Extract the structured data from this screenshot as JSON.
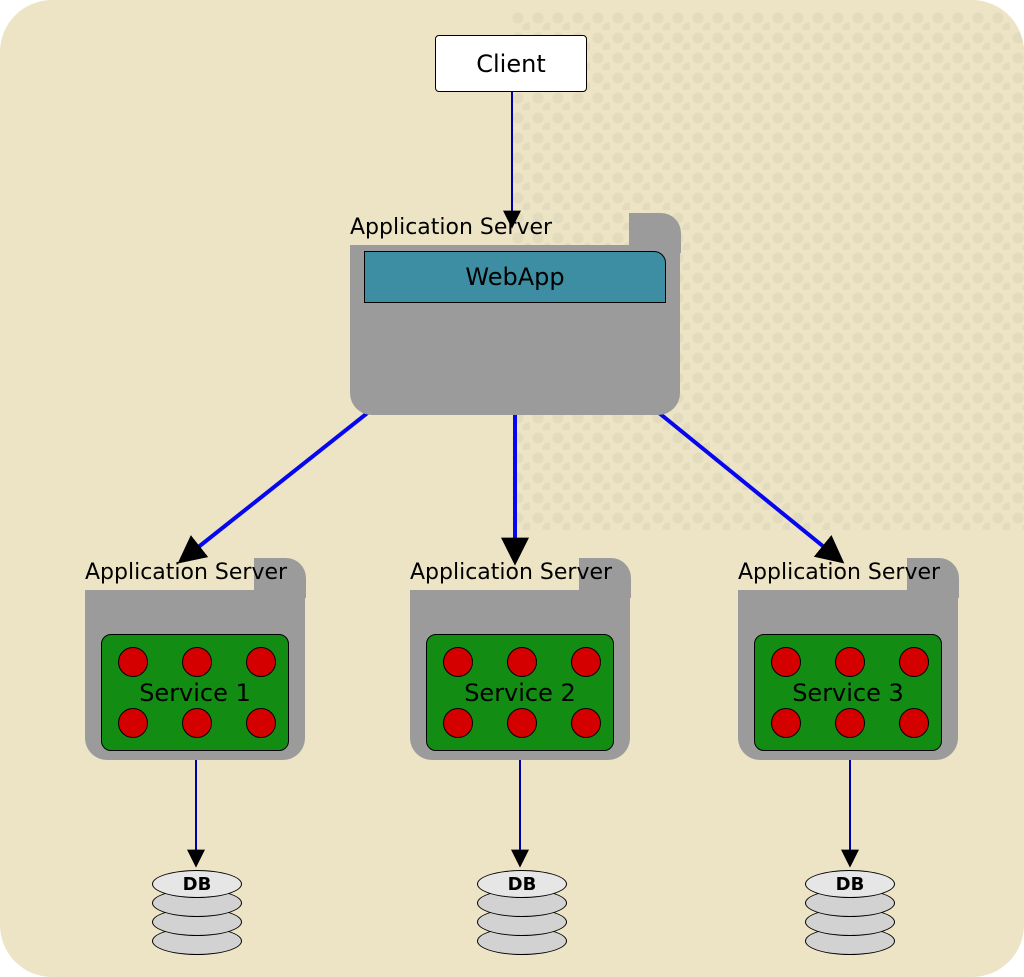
{
  "client_label": "Client",
  "webapp": {
    "server_title": "Application Server",
    "label": "WebApp"
  },
  "services": [
    {
      "server_title": "Application Server",
      "label": "Service 1",
      "db_label": "DB"
    },
    {
      "server_title": "Application Server",
      "label": "Service 2",
      "db_label": "DB"
    },
    {
      "server_title": "Application Server",
      "label": "Service 3",
      "db_label": "DB"
    }
  ],
  "colors": {
    "background": "#ece4c5",
    "server_body": "#9b9b9b",
    "webapp_bar": "#3d8ea2",
    "service_chip": "#138c13",
    "service_dot": "#d40000",
    "arrow_thin": "#0000aa",
    "arrow_thick_stroke": "#0707ef"
  }
}
